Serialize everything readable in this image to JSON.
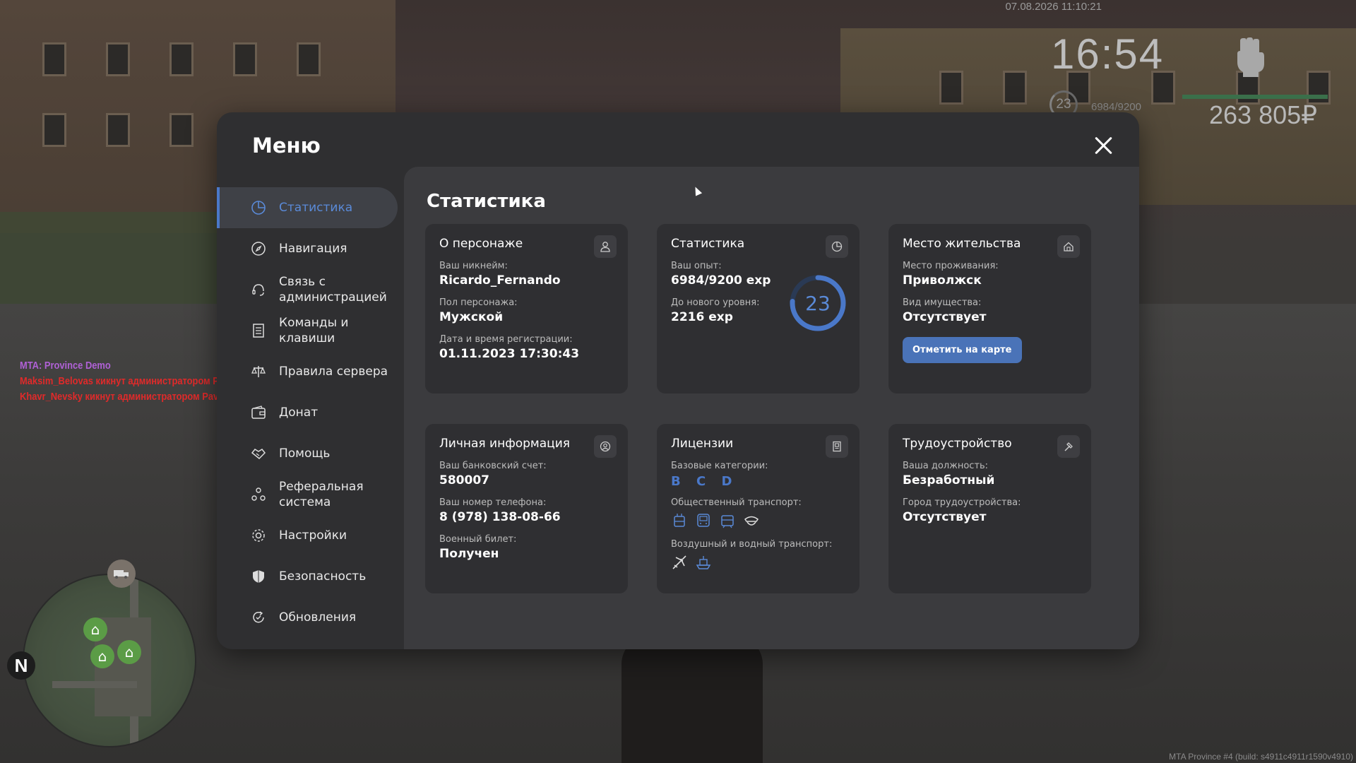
{
  "hud": {
    "datetime": "07.08.2026 11:10:21",
    "time": "16:54",
    "level": "23",
    "exp": "6984/9200",
    "exp_progress": 0.76,
    "money": "263 805₽"
  },
  "chat": [
    "MTA: Province Demo",
    "Maksim_Belovas кикнут администратором Pavel_Belin (помеха игроку)",
    "Khavr_Nevsky кикнут администратором Pavel_Belin (помеха игроку)"
  ],
  "minimap": {
    "north": "N"
  },
  "build": "MTA Province #4 (build: s4911c4911r1590v4910)",
  "menu": {
    "title": "Меню",
    "items": [
      {
        "label": "Статистика",
        "icon": "pie-chart-icon",
        "active": true
      },
      {
        "label": "Навигация",
        "icon": "compass-icon"
      },
      {
        "label": "Связь с администрацией",
        "icon": "headset-icon"
      },
      {
        "label": "Команды и клавиши",
        "icon": "document-icon"
      },
      {
        "label": "Правила сервера",
        "icon": "scales-icon"
      },
      {
        "label": "Донат",
        "icon": "wallet-icon"
      },
      {
        "label": "Помощь",
        "icon": "handshake-icon"
      },
      {
        "label": "Реферальная система",
        "icon": "people-icon"
      },
      {
        "label": "Настройки",
        "icon": "gear-icon"
      },
      {
        "label": "Безопасность",
        "icon": "shield-icon"
      },
      {
        "label": "Обновления",
        "icon": "refresh-icon"
      }
    ]
  },
  "content": {
    "title": "Статистика",
    "character": {
      "title": "О персонаже",
      "nick_label": "Ваш никнейм:",
      "nick": "Ricardo_Fernando",
      "gender_label": "Пол персонажа:",
      "gender": "Мужской",
      "reg_label": "Дата и время регистрации:",
      "reg": "01.11.2023 17:30:43"
    },
    "stats": {
      "title": "Статистика",
      "exp_label": "Ваш опыт:",
      "exp": "6984/9200 exp",
      "next_label": "До нового уровня:",
      "next": "2216 exp",
      "level": "23",
      "progress": 0.76
    },
    "residence": {
      "title": "Место жительства",
      "place_label": "Место проживания:",
      "place": "Приволжск",
      "property_label": "Вид имущества:",
      "property": "Отсутствует",
      "button": "Отметить на карте"
    },
    "personal": {
      "title": "Личная информация",
      "bank_label": "Ваш банковский счет:",
      "bank": "580007",
      "phone_label": "Ваш номер телефона:",
      "phone": "8 (978) 138-08-66",
      "military_label": "Военный билет:",
      "military": "Получен"
    },
    "licenses": {
      "title": "Лицензии",
      "base_label": "Базовые категории:",
      "base": "B C D",
      "public_label": "Общественный транспорт:",
      "air_label": "Воздушный и водный транспорт:"
    },
    "employment": {
      "title": "Трудоустройство",
      "position_label": "Ваша должность:",
      "position": "Безработный",
      "city_label": "Город трудоустройства:",
      "city": "Отсутствует"
    }
  }
}
